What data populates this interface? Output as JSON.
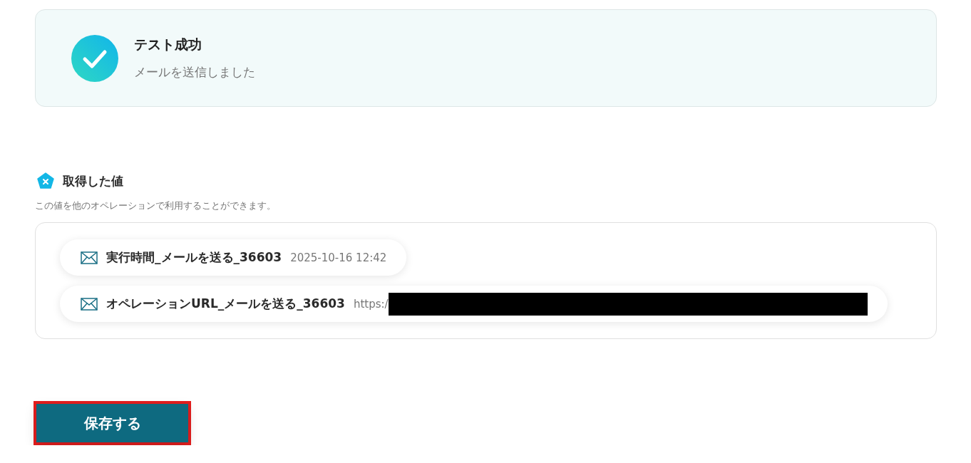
{
  "result": {
    "succeeded": true,
    "title": "テスト成功",
    "message": "メールを送信しました"
  },
  "section": {
    "title": "取得した値",
    "description": "この値を他のオペレーションで利用することができます。"
  },
  "values": [
    {
      "label": "実行時間_メールを送る_36603",
      "value": "2025-10-16 12:42",
      "redacted": false
    },
    {
      "label": "オペレーションURL_メールを送る_36603",
      "value": "https:/",
      "redacted": true
    }
  ],
  "save_button": {
    "label": "保存する",
    "highlighted": true
  }
}
